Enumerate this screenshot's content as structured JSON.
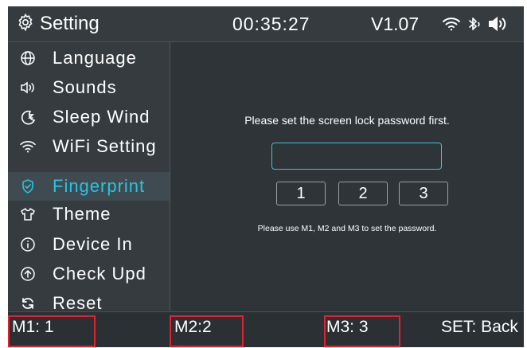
{
  "header": {
    "title": "Setting",
    "time": "00:35:27",
    "version": "V1.07",
    "icons": [
      "gear-icon",
      "wifi-icon",
      "bluetooth-icon",
      "volume-icon"
    ]
  },
  "sidebar": {
    "items": [
      {
        "label": "Language",
        "icon": "globe-icon",
        "active": false
      },
      {
        "label": "Sounds",
        "icon": "speaker-icon",
        "active": false
      },
      {
        "label": "Sleep Wind",
        "icon": "moon-icon",
        "active": false
      },
      {
        "label": "WiFi Setting",
        "icon": "wifi-icon",
        "active": false
      },
      {
        "label": "Fingerprint",
        "icon": "shield-icon",
        "active": true
      },
      {
        "label": "Theme",
        "icon": "shirt-icon",
        "active": false
      },
      {
        "label": "Device In",
        "icon": "info-icon",
        "active": false
      },
      {
        "label": "Check Upd",
        "icon": "upload-icon",
        "active": false
      },
      {
        "label": "Reset",
        "icon": "refresh-icon",
        "active": false
      }
    ]
  },
  "main": {
    "prompt": "Please set the screen lock password first.",
    "password_value": "",
    "keys": [
      "1",
      "2",
      "3"
    ],
    "hint": "Please use M1, M2 and M3 to set the password."
  },
  "footer": {
    "m1": "M1: 1",
    "m2": "M2:2",
    "m3": "M3: 3",
    "set": "SET: Back"
  },
  "colors": {
    "accent": "#28c4df",
    "background": "#2e3438",
    "highlight_box": "#e0222a"
  }
}
